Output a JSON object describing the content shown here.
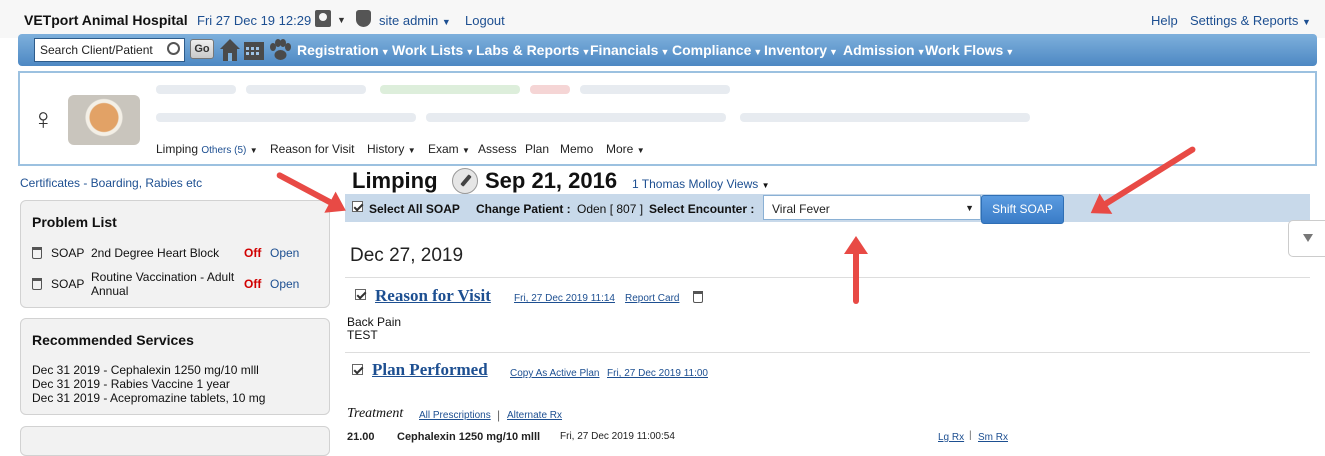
{
  "header": {
    "brand": "VETport Animal Hospital",
    "datetime": "Fri 27 Dec 19 12:29",
    "user": "site admin",
    "logout": "Logout",
    "help": "Help",
    "settings": "Settings & Reports"
  },
  "nav": {
    "search_placeholder": "Search Client/Patient",
    "go": "Go",
    "menus": [
      "Registration",
      "Work Lists",
      "Labs & Reports",
      "Financials",
      "Compliance",
      "Inventory",
      "Admission",
      "Work Flows"
    ]
  },
  "patient_nav": {
    "items": [
      "Limping",
      "Others (5)",
      "Reason for Visit",
      "History",
      "Exam",
      "Assess",
      "Plan",
      "Memo",
      "More"
    ]
  },
  "sidebar": {
    "certificates": "Certificates - Boarding, Rabies etc",
    "problem_list": {
      "title": "Problem List",
      "rows": [
        {
          "type": "SOAP",
          "name": "2nd Degree Heart Block",
          "status": "Off",
          "action": "Open"
        },
        {
          "type": "SOAP",
          "name": "Routine Vaccination - Adult Annual",
          "status": "Off",
          "action": "Open"
        }
      ]
    },
    "recommended": {
      "title": "Recommended Services",
      "items": [
        "Dec 31 2019 - Cephalexin 1250 mg/10 mlll",
        "Dec 31 2019 - Rabies Vaccine 1 year",
        "Dec 31 2019 - Acepromazine tablets, 10 mg"
      ]
    }
  },
  "soap": {
    "title": "Limping",
    "date": "Sep 21, 2016",
    "views": "1 Thomas Molloy Views",
    "select_all": "Select All SOAP",
    "change_patient_label": "Change Patient :",
    "patient_value": "Oden [ 807 ]",
    "select_encounter_label": "Select Encounter :",
    "encounter_value": "Viral Fever",
    "shift_button": "Shift SOAP",
    "entry_date": "Dec 27, 2019",
    "reason": {
      "title": "Reason for Visit",
      "timestamp": "Fri, 27 Dec 2019 11:14",
      "report_card": "Report Card",
      "line1": "Back Pain",
      "line2": "TEST"
    },
    "plan": {
      "title": "Plan Performed",
      "copy": "Copy As Active Plan",
      "timestamp": "Fri, 27 Dec 2019 11:00"
    },
    "treatment": {
      "label": "Treatment",
      "all_prescriptions": "All Prescriptions",
      "alternate": "Alternate Rx",
      "qty": "21.00",
      "drug": "Cephalexin 1250 mg/10 mlll",
      "drug_time": "Fri, 27 Dec 2019 11:00:54",
      "lg": "Lg Rx",
      "sm": "Sm Rx"
    }
  },
  "colors": {
    "nav_bar": "#5b95cc",
    "link": "#1d4f91",
    "off": "#d10000",
    "arrow": "#e84a45",
    "shift_button": "#3f82cc"
  }
}
